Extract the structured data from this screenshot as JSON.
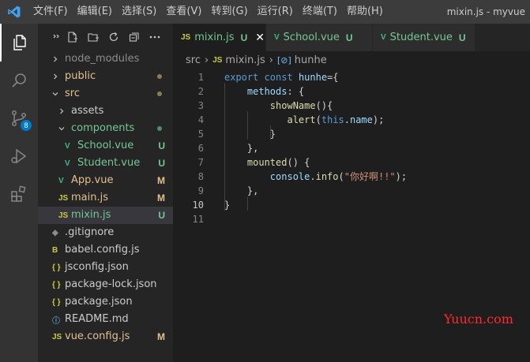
{
  "menu": [
    "文件(F)",
    "编辑(E)",
    "选择(S)",
    "查看(V)",
    "转到(G)",
    "运行(R)",
    "终端(T)",
    "帮助(H)"
  ],
  "window_title": "mixin.js - myvue",
  "activity": {
    "scm_badge": "8"
  },
  "explorer": {
    "items": [
      {
        "name": "node_modules",
        "type": "folder",
        "expanded": false,
        "depth": 0,
        "color": "#8c8c8c",
        "status": ""
      },
      {
        "name": "public",
        "type": "folder",
        "expanded": false,
        "depth": 0,
        "color": "#e2c08d",
        "status": "dot-modified"
      },
      {
        "name": "src",
        "type": "folder",
        "expanded": true,
        "depth": 0,
        "color": "#e2c08d",
        "status": "dot-modified"
      },
      {
        "name": "assets",
        "type": "folder",
        "expanded": false,
        "depth": 1,
        "color": "#cccccc",
        "status": ""
      },
      {
        "name": "components",
        "type": "folder",
        "expanded": true,
        "depth": 1,
        "color": "#73c991",
        "status": "dot-untracked"
      },
      {
        "name": "School.vue",
        "type": "vue",
        "depth": 2,
        "color": "#73c991",
        "status": "U"
      },
      {
        "name": "Student.vue",
        "type": "vue",
        "depth": 2,
        "color": "#73c991",
        "status": "U"
      },
      {
        "name": "App.vue",
        "type": "vue",
        "depth": 1,
        "color": "#e2c08d",
        "status": "M"
      },
      {
        "name": "main.js",
        "type": "js",
        "depth": 1,
        "color": "#e2c08d",
        "status": "M"
      },
      {
        "name": "mixin.js",
        "type": "js",
        "depth": 1,
        "color": "#73c991",
        "status": "U",
        "selected": true
      },
      {
        "name": ".gitignore",
        "type": "git",
        "depth": 0,
        "color": "#cccccc",
        "status": ""
      },
      {
        "name": "babel.config.js",
        "type": "babel",
        "depth": 0,
        "color": "#cccccc",
        "status": ""
      },
      {
        "name": "jsconfig.json",
        "type": "json",
        "depth": 0,
        "color": "#cccccc",
        "status": ""
      },
      {
        "name": "package-lock.json",
        "type": "json",
        "depth": 0,
        "color": "#cccccc",
        "status": ""
      },
      {
        "name": "package.json",
        "type": "json",
        "depth": 0,
        "color": "#cccccc",
        "status": ""
      },
      {
        "name": "README.md",
        "type": "info",
        "depth": 0,
        "color": "#cccccc",
        "status": ""
      },
      {
        "name": "vue.config.js",
        "type": "js",
        "depth": 0,
        "color": "#e2c08d",
        "status": "M"
      }
    ]
  },
  "tabs": [
    {
      "icon": "JS",
      "label": "mixin.js",
      "status": "U",
      "active": true
    },
    {
      "icon": "V",
      "label": "School.vue",
      "status": "U",
      "active": false
    },
    {
      "icon": "V",
      "label": "Student.vue",
      "status": "U",
      "active": false
    }
  ],
  "breadcrumb": {
    "folder": "src",
    "file": "mixin.js",
    "symbol": "hunhe"
  },
  "code_lines": [
    {
      "n": "1",
      "tokens": [
        [
          "kw",
          "export "
        ],
        [
          "kw",
          "const "
        ],
        [
          "id",
          "hunhe"
        ],
        [
          "pn",
          "="
        ],
        [
          "pn",
          "{"
        ]
      ]
    },
    {
      "n": "2",
      "tokens": [
        [
          "pn",
          "    "
        ],
        [
          "id",
          "methods"
        ],
        [
          "pn",
          ": {"
        ]
      ]
    },
    {
      "n": "3",
      "tokens": [
        [
          "pn",
          "        "
        ],
        [
          "fn",
          "showName"
        ],
        [
          "pn",
          "(){"
        ]
      ]
    },
    {
      "n": "4",
      "tokens": [
        [
          "pn",
          "           "
        ],
        [
          "fn",
          "alert"
        ],
        [
          "pn",
          "("
        ],
        [
          "kw",
          "this"
        ],
        [
          "pn",
          "."
        ],
        [
          "id",
          "name"
        ],
        [
          "pn",
          ");"
        ]
      ]
    },
    {
      "n": "5",
      "tokens": [
        [
          "pn",
          "        }"
        ]
      ]
    },
    {
      "n": "6",
      "tokens": [
        [
          "pn",
          "    },"
        ]
      ]
    },
    {
      "n": "7",
      "tokens": [
        [
          "pn",
          "    "
        ],
        [
          "fn",
          "mounted"
        ],
        [
          "pn",
          "() {"
        ]
      ]
    },
    {
      "n": "8",
      "tokens": [
        [
          "pn",
          "        "
        ],
        [
          "id",
          "console"
        ],
        [
          "pn",
          "."
        ],
        [
          "fn",
          "info"
        ],
        [
          "pn",
          "("
        ],
        [
          "str",
          "\"你好啊!!\""
        ],
        [
          "pn",
          ");"
        ]
      ]
    },
    {
      "n": "9",
      "tokens": [
        [
          "pn",
          "    },"
        ]
      ]
    },
    {
      "n": "10",
      "tokens": [
        [
          "pn",
          "}"
        ]
      ]
    },
    {
      "n": "11",
      "tokens": []
    }
  ],
  "current_line": "10",
  "watermark": "Yuucn.com",
  "colors": {
    "accent": "#007acc",
    "untracked": "#73c991",
    "modified": "#e2c08d"
  }
}
